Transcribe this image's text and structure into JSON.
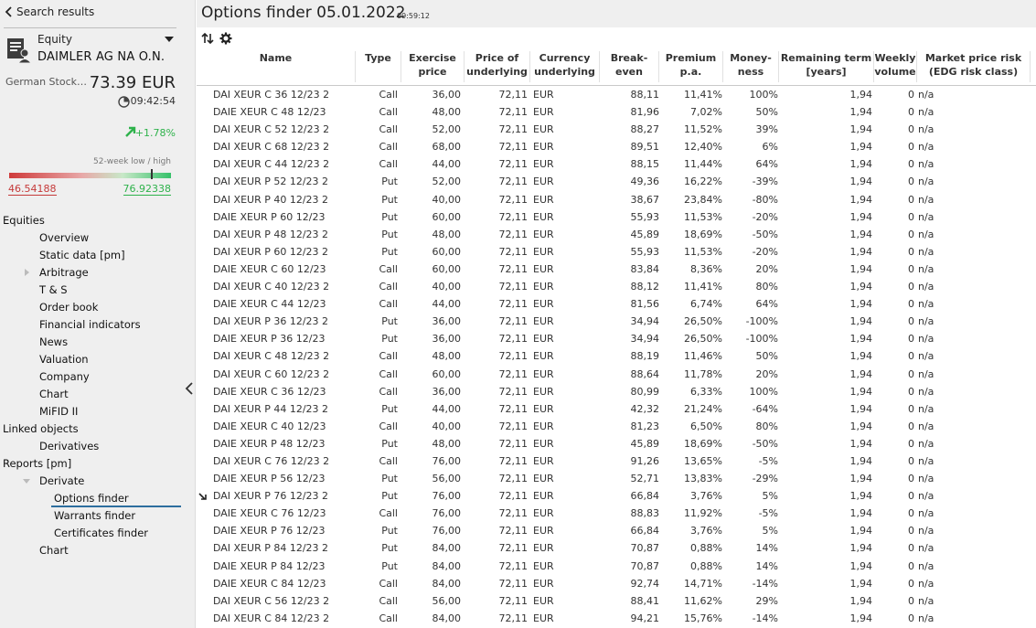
{
  "sidebar": {
    "back_label": "Search results",
    "security_type": "Equity",
    "security_name": "DAIMLER AG NA O.N.",
    "exchange": "German Stock Exchange",
    "price": "73.39 EUR",
    "time": "09:42:54",
    "change": "+1.78%",
    "range_caption": "52-week low / high",
    "range_low": "46.54188",
    "range_high": "76.92338",
    "range_current_fraction": 0.88,
    "colors": {
      "positive": "#2eb24b",
      "negative": "#c53a3a",
      "accent": "#2d6e9e"
    },
    "nav": [
      {
        "label": "Equities",
        "level": 0
      },
      {
        "label": "Overview",
        "level": 1
      },
      {
        "label": "Static data [pm]",
        "level": 1
      },
      {
        "label": "Arbitrage",
        "level": 1,
        "expander": "collapsed"
      },
      {
        "label": "T & S",
        "level": 1
      },
      {
        "label": "Order book",
        "level": 1
      },
      {
        "label": "Financial indicators",
        "level": 1
      },
      {
        "label": "News",
        "level": 1
      },
      {
        "label": "Valuation",
        "level": 1
      },
      {
        "label": "Company",
        "level": 1
      },
      {
        "label": "Chart",
        "level": 1
      },
      {
        "label": "MiFID II",
        "level": 1
      },
      {
        "label": "Linked objects",
        "level": 0
      },
      {
        "label": "Derivatives",
        "level": 1
      },
      {
        "label": "Reports [pm]",
        "level": 0
      },
      {
        "label": "Derivate",
        "level": 1,
        "expander": "expanded"
      },
      {
        "label": "Options finder",
        "level": 2,
        "active": true
      },
      {
        "label": "Warrants finder",
        "level": 2
      },
      {
        "label": "Certificates finder",
        "level": 2
      },
      {
        "label": "Chart",
        "level": 1
      }
    ]
  },
  "main": {
    "title": "Options finder 05.01.2022",
    "time": "09:59:12",
    "toolbar": {
      "sort_icon": "sort-icon",
      "settings_icon": "gear-icon"
    },
    "columns": [
      {
        "key": "name",
        "label": "Name"
      },
      {
        "key": "type",
        "label": "Type"
      },
      {
        "key": "exercise",
        "label": "Exercise price"
      },
      {
        "key": "underlying_price",
        "label": "Price of underlying"
      },
      {
        "key": "currency",
        "label": "Currency underlying"
      },
      {
        "key": "breakeven",
        "label": "Break-even"
      },
      {
        "key": "premium",
        "label": "Premium p.a."
      },
      {
        "key": "moneyness",
        "label": "Money-ness"
      },
      {
        "key": "term",
        "label": "Remaining term [years]"
      },
      {
        "key": "volume",
        "label": "Weekly volume"
      },
      {
        "key": "risk",
        "label": "Market price risk (EDG risk class)"
      }
    ],
    "rows": [
      [
        "DAI XEUR C 36 12/23 2",
        "Call",
        "36,00",
        "72,11",
        "EUR",
        "88,11",
        "11,41%",
        "100%",
        "1,94",
        "0",
        "n/a"
      ],
      [
        "DAIE XEUR C 48 12/23",
        "Call",
        "48,00",
        "72,11",
        "EUR",
        "81,96",
        "7,02%",
        "50%",
        "1,94",
        "0",
        "n/a"
      ],
      [
        "DAI XEUR C 52 12/23 2",
        "Call",
        "52,00",
        "72,11",
        "EUR",
        "88,27",
        "11,52%",
        "39%",
        "1,94",
        "0",
        "n/a"
      ],
      [
        "DAI XEUR C 68 12/23 2",
        "Call",
        "68,00",
        "72,11",
        "EUR",
        "89,51",
        "12,40%",
        "6%",
        "1,94",
        "0",
        "n/a"
      ],
      [
        "DAI XEUR C 44 12/23 2",
        "Call",
        "44,00",
        "72,11",
        "EUR",
        "88,15",
        "11,44%",
        "64%",
        "1,94",
        "0",
        "n/a"
      ],
      [
        "DAI XEUR P 52 12/23 2",
        "Put",
        "52,00",
        "72,11",
        "EUR",
        "49,36",
        "16,22%",
        "-39%",
        "1,94",
        "0",
        "n/a"
      ],
      [
        "DAI XEUR P 40 12/23 2",
        "Put",
        "40,00",
        "72,11",
        "EUR",
        "38,67",
        "23,84%",
        "-80%",
        "1,94",
        "0",
        "n/a"
      ],
      [
        "DAIE XEUR P 60 12/23",
        "Put",
        "60,00",
        "72,11",
        "EUR",
        "55,93",
        "11,53%",
        "-20%",
        "1,94",
        "0",
        "n/a"
      ],
      [
        "DAI XEUR P 48 12/23 2",
        "Put",
        "48,00",
        "72,11",
        "EUR",
        "45,89",
        "18,69%",
        "-50%",
        "1,94",
        "0",
        "n/a"
      ],
      [
        "DAI XEUR P 60 12/23 2",
        "Put",
        "60,00",
        "72,11",
        "EUR",
        "55,93",
        "11,53%",
        "-20%",
        "1,94",
        "0",
        "n/a"
      ],
      [
        "DAIE XEUR C 60 12/23",
        "Call",
        "60,00",
        "72,11",
        "EUR",
        "83,84",
        "8,36%",
        "20%",
        "1,94",
        "0",
        "n/a"
      ],
      [
        "DAI XEUR C 40 12/23 2",
        "Call",
        "40,00",
        "72,11",
        "EUR",
        "88,12",
        "11,41%",
        "80%",
        "1,94",
        "0",
        "n/a"
      ],
      [
        "DAIE XEUR C 44 12/23",
        "Call",
        "44,00",
        "72,11",
        "EUR",
        "81,56",
        "6,74%",
        "64%",
        "1,94",
        "0",
        "n/a"
      ],
      [
        "DAI XEUR P 36 12/23 2",
        "Put",
        "36,00",
        "72,11",
        "EUR",
        "34,94",
        "26,50%",
        "-100%",
        "1,94",
        "0",
        "n/a"
      ],
      [
        "DAIE XEUR P 36 12/23",
        "Put",
        "36,00",
        "72,11",
        "EUR",
        "34,94",
        "26,50%",
        "-100%",
        "1,94",
        "0",
        "n/a"
      ],
      [
        "DAI XEUR C 48 12/23 2",
        "Call",
        "48,00",
        "72,11",
        "EUR",
        "88,19",
        "11,46%",
        "50%",
        "1,94",
        "0",
        "n/a"
      ],
      [
        "DAI XEUR C 60 12/23 2",
        "Call",
        "60,00",
        "72,11",
        "EUR",
        "88,64",
        "11,78%",
        "20%",
        "1,94",
        "0",
        "n/a"
      ],
      [
        "DAIE XEUR C 36 12/23",
        "Call",
        "36,00",
        "72,11",
        "EUR",
        "80,99",
        "6,33%",
        "100%",
        "1,94",
        "0",
        "n/a"
      ],
      [
        "DAI XEUR P 44 12/23 2",
        "Put",
        "44,00",
        "72,11",
        "EUR",
        "42,32",
        "21,24%",
        "-64%",
        "1,94",
        "0",
        "n/a"
      ],
      [
        "DAIE XEUR C 40 12/23",
        "Call",
        "40,00",
        "72,11",
        "EUR",
        "81,23",
        "6,50%",
        "80%",
        "1,94",
        "0",
        "n/a"
      ],
      [
        "DAIE XEUR P 48 12/23",
        "Put",
        "48,00",
        "72,11",
        "EUR",
        "45,89",
        "18,69%",
        "-50%",
        "1,94",
        "0",
        "n/a"
      ],
      [
        "DAI XEUR C 76 12/23 2",
        "Call",
        "76,00",
        "72,11",
        "EUR",
        "91,26",
        "13,65%",
        "-5%",
        "1,94",
        "0",
        "n/a"
      ],
      [
        "DAIE XEUR P 56 12/23",
        "Put",
        "56,00",
        "72,11",
        "EUR",
        "52,71",
        "13,83%",
        "-29%",
        "1,94",
        "0",
        "n/a"
      ],
      [
        "DAI XEUR P 76 12/23 2",
        "Put",
        "76,00",
        "72,11",
        "EUR",
        "66,84",
        "3,76%",
        "5%",
        "1,94",
        "0",
        "n/a"
      ],
      [
        "DAIE XEUR C 76 12/23",
        "Call",
        "76,00",
        "72,11",
        "EUR",
        "88,83",
        "11,92%",
        "-5%",
        "1,94",
        "0",
        "n/a"
      ],
      [
        "DAIE XEUR P 76 12/23",
        "Put",
        "76,00",
        "72,11",
        "EUR",
        "66,84",
        "3,76%",
        "5%",
        "1,94",
        "0",
        "n/a"
      ],
      [
        "DAI XEUR P 84 12/23 2",
        "Put",
        "84,00",
        "72,11",
        "EUR",
        "70,87",
        "0,88%",
        "14%",
        "1,94",
        "0",
        "n/a"
      ],
      [
        "DAIE XEUR P 84 12/23",
        "Put",
        "84,00",
        "72,11",
        "EUR",
        "70,87",
        "0,88%",
        "14%",
        "1,94",
        "0",
        "n/a"
      ],
      [
        "DAIE XEUR C 84 12/23",
        "Call",
        "84,00",
        "72,11",
        "EUR",
        "92,74",
        "14,71%",
        "-14%",
        "1,94",
        "0",
        "n/a"
      ],
      [
        "DAI XEUR C 56 12/23 2",
        "Call",
        "56,00",
        "72,11",
        "EUR",
        "88,41",
        "11,62%",
        "29%",
        "1,94",
        "0",
        "n/a"
      ],
      [
        "DAI XEUR C 84 12/23 2",
        "Call",
        "84,00",
        "72,11",
        "EUR",
        "94,21",
        "15,76%",
        "-14%",
        "1,94",
        "0",
        "n/a"
      ]
    ],
    "marked_row": 23
  }
}
